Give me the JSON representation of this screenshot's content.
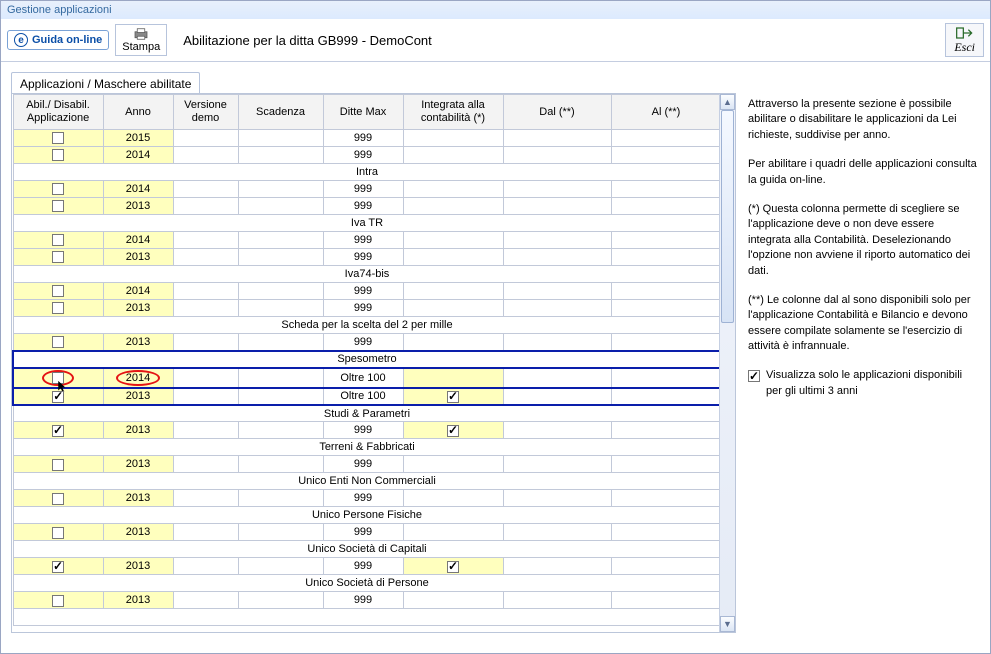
{
  "window_title": "Gestione applicazioni",
  "toolbar": {
    "guide_label": "Guida on-line",
    "stampa_label": "Stampa",
    "main_title": "Abilitazione per la ditta GB999 -  DemoCont",
    "esci_label": "Esci"
  },
  "tab_label": "Applicazioni / Maschere abilitate",
  "columns": {
    "c0": "Abil./ Disabil. Applicazione",
    "c1": "Anno",
    "c2": "Versione demo",
    "c3": "Scadenza",
    "c4": "Ditte Max",
    "c5": "Integrata alla contabilità (*)",
    "c6": "Dal (**)",
    "c7": "Al (**)"
  },
  "sections": {
    "intra": "Intra",
    "ivatr": "Iva TR",
    "iva74": "Iva74-bis",
    "scheda": "Scheda per la scelta del 2 per mille",
    "speso": "Spesometro",
    "studi": "Studi & Parametri",
    "terreni": "Terreni & Fabbricati",
    "unicoenti": "Unico Enti Non Commerciali",
    "unicopf": "Unico Persone Fisiche",
    "unicosc": "Unico Società di Capitali",
    "unicosp": "Unico Società di Persone"
  },
  "rows": {
    "pre1": {
      "anno": "2015",
      "ditte": "999"
    },
    "pre2": {
      "anno": "2014",
      "ditte": "999"
    },
    "intra1": {
      "anno": "2014",
      "ditte": "999"
    },
    "intra2": {
      "anno": "2013",
      "ditte": "999"
    },
    "ivatr1": {
      "anno": "2014",
      "ditte": "999"
    },
    "ivatr2": {
      "anno": "2013",
      "ditte": "999"
    },
    "iva74_1": {
      "anno": "2014",
      "ditte": "999"
    },
    "iva74_2": {
      "anno": "2013",
      "ditte": "999"
    },
    "scheda1": {
      "anno": "2013",
      "ditte": "999"
    },
    "speso1": {
      "anno": "2014",
      "ditte": "Oltre 100"
    },
    "speso2": {
      "anno": "2013",
      "ditte": "Oltre 100"
    },
    "studi1": {
      "anno": "2013",
      "ditte": "999"
    },
    "terreni1": {
      "anno": "2013",
      "ditte": "999"
    },
    "unicoenti1": {
      "anno": "2013",
      "ditte": "999"
    },
    "unicopf1": {
      "anno": "2013",
      "ditte": "999"
    },
    "unicosc1": {
      "anno": "2013",
      "ditte": "999"
    },
    "unicosp1": {
      "anno": "2013",
      "ditte": "999"
    }
  },
  "sidebar": {
    "p1": "Attraverso la presente sezione è possibile abilitare o disabilitare le applicazioni da Lei richieste, suddivise per anno.",
    "p2": "Per abilitare i quadri delle applicazioni consulta la guida on-line.",
    "p3": "(*) Questa colonna permette di scegliere se l'applicazione deve o non deve essere integrata alla Contabilità. Deselezionando l'opzione non avviene il riporto automatico dei dati.",
    "p4": "(**) Le colonne dal al sono disponibili solo per l'applicazione Contabilità e Bilancio e devono essere compilate solamente se l'esercizio di attività è infrannuale.",
    "check_label": "Visualizza solo le applicazioni disponibili per gli ultimi 3 anni"
  }
}
